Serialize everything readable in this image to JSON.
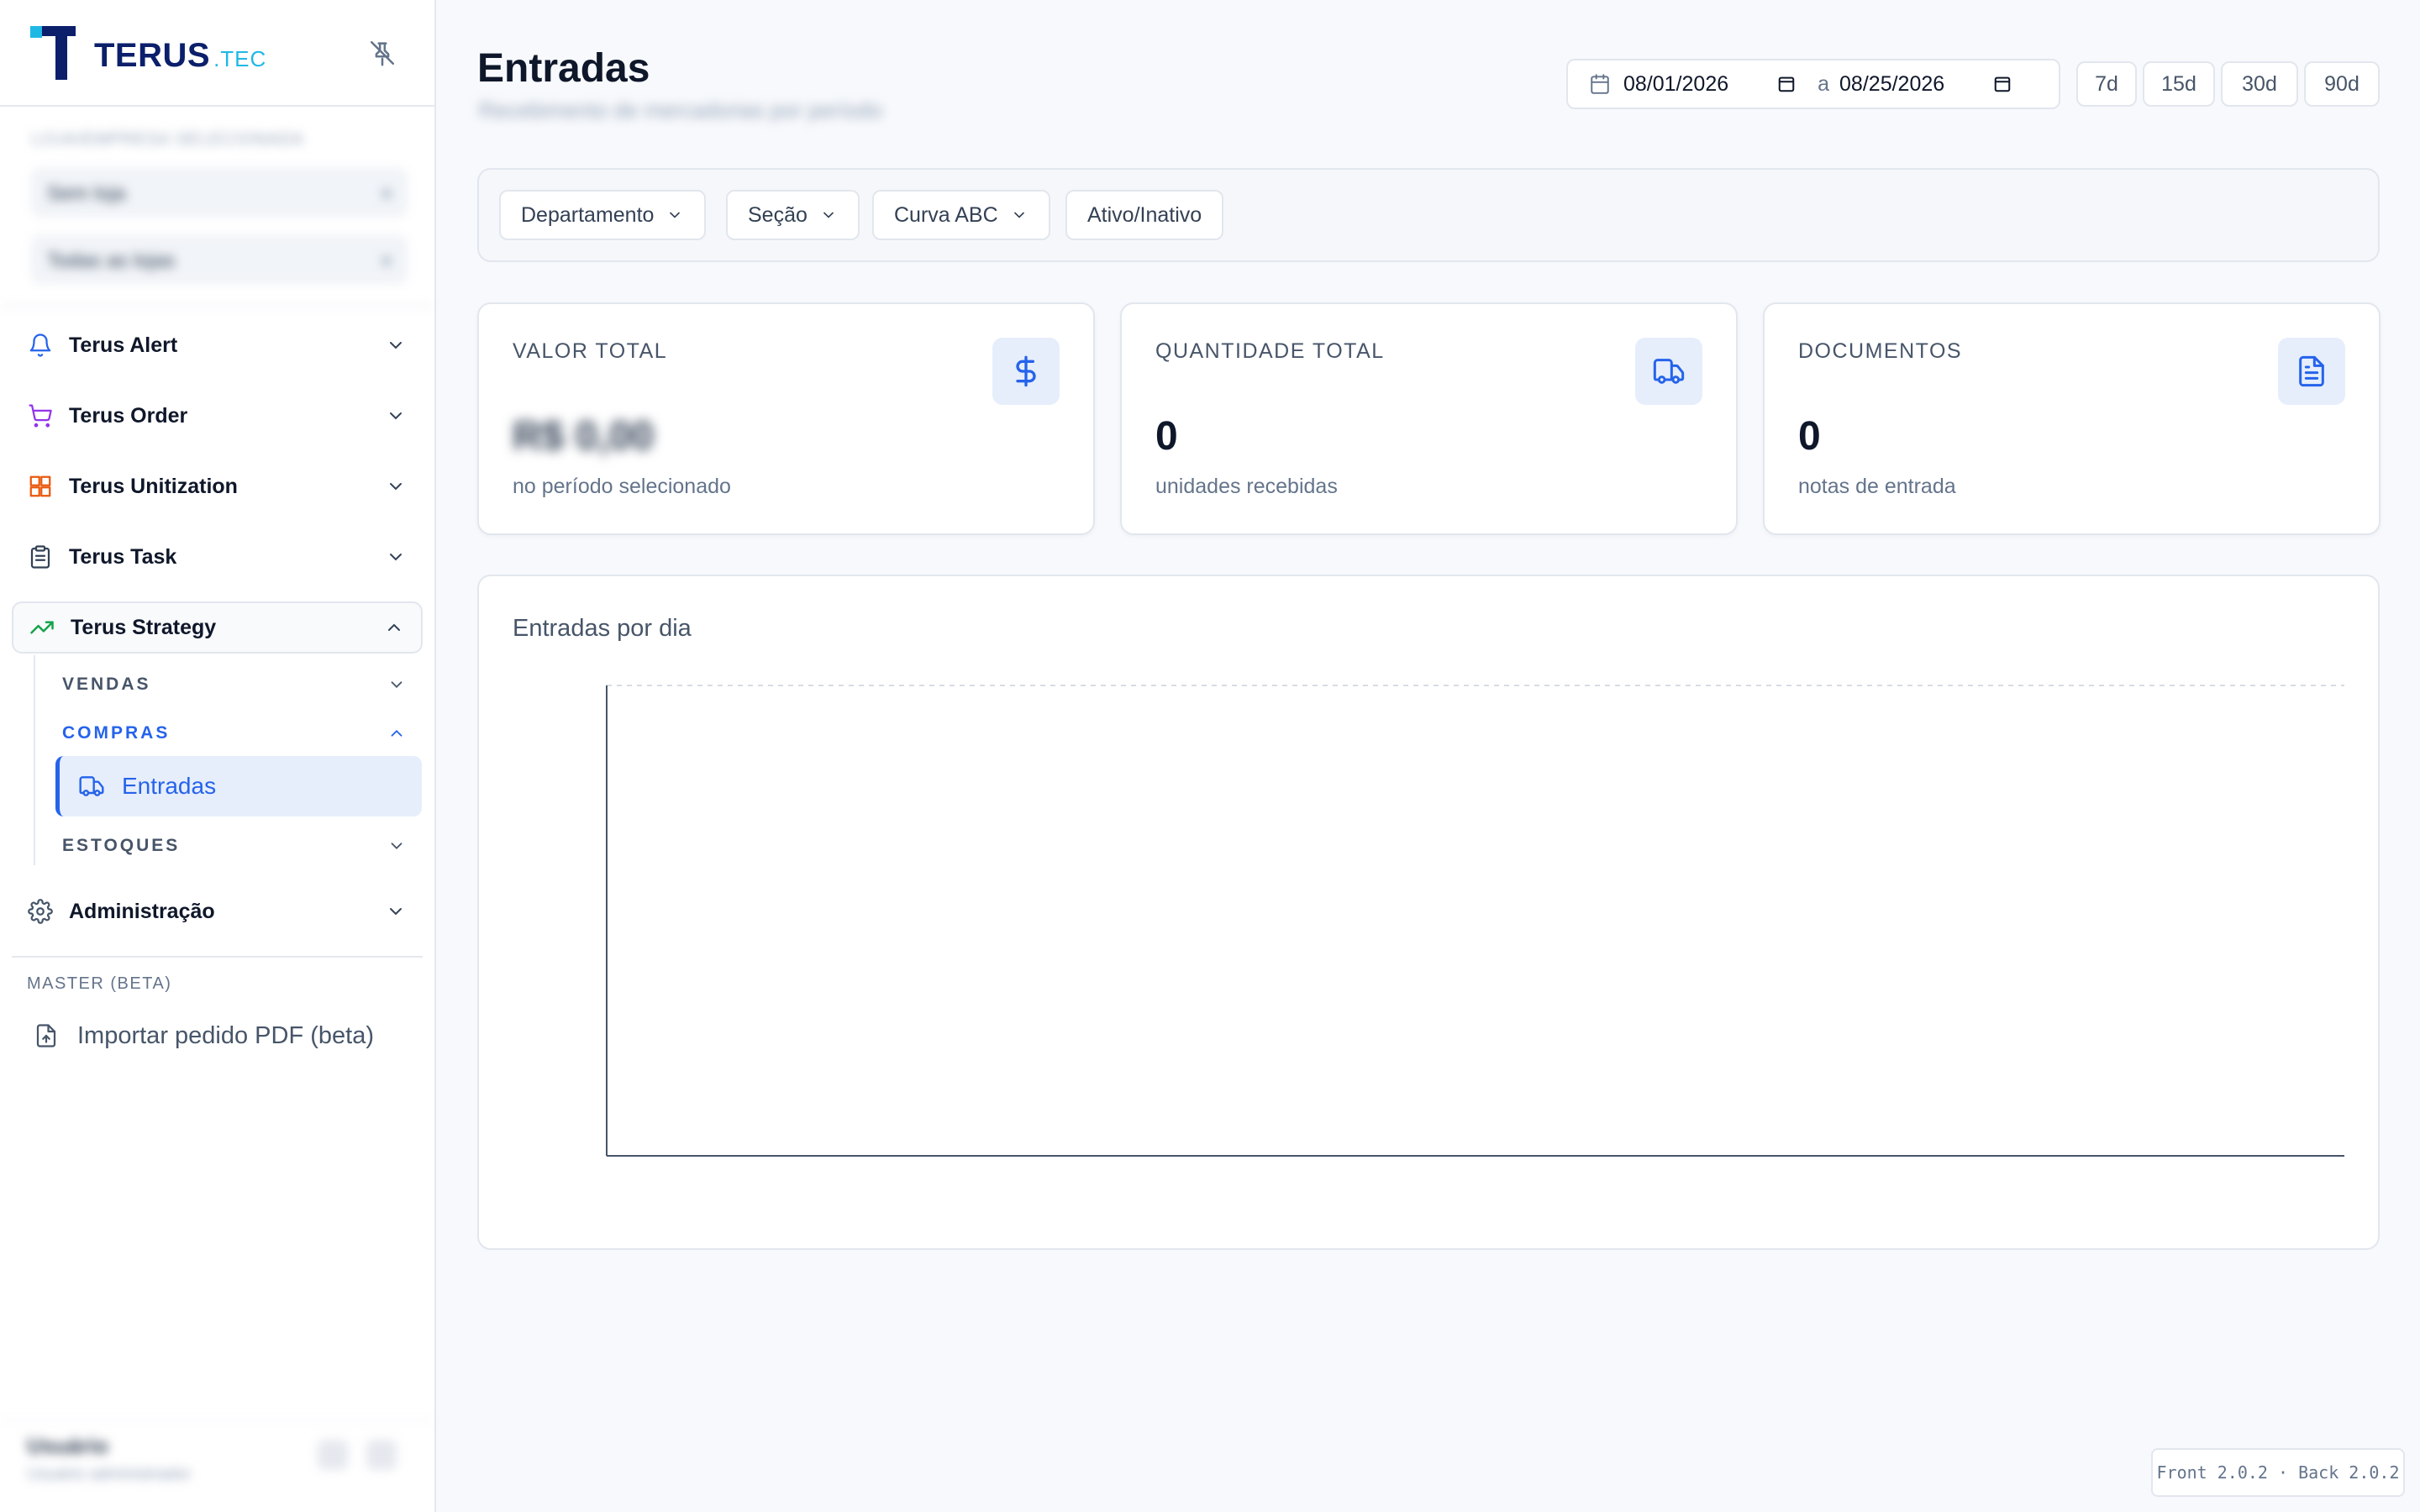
{
  "brand": {
    "name": "TERUS",
    "suffix": ".TEC"
  },
  "sidebar": {
    "selector_label": "LOJA/EMPRESA SELECIONADA",
    "selector_primary": "Sem loja",
    "selector_secondary": "Todas as lojas",
    "items": [
      {
        "label": "Terus Alert"
      },
      {
        "label": "Terus Order"
      },
      {
        "label": "Terus Unitization"
      },
      {
        "label": "Terus Task"
      },
      {
        "label": "Terus Strategy"
      },
      {
        "label": "Administração"
      }
    ],
    "strategy_sub": [
      {
        "label": "VENDAS"
      },
      {
        "label": "COMPRAS"
      },
      {
        "label": "ESTOQUES"
      }
    ],
    "active_leaf": "Entradas",
    "master_section": "MASTER (BETA)",
    "import_pdf": "Importar pedido PDF (beta)",
    "user_name": "Usuário",
    "user_role": "Usuário administrador"
  },
  "header": {
    "title": "Entradas",
    "subtitle": "Recebimento de mercadorias por período",
    "date_from": "08/01/2026",
    "date_separator": "a",
    "date_to": "08/25/2026",
    "presets": [
      "7d",
      "15d",
      "30d",
      "90d"
    ]
  },
  "filters": [
    "Departamento",
    "Seção",
    "Curva ABC",
    "Ativo/Inativo"
  ],
  "kpis": [
    {
      "title": "VALOR TOTAL",
      "value": "R$ 0,00",
      "sub": "no período selecionado",
      "icon": "dollar-icon"
    },
    {
      "title": "QUANTIDADE TOTAL",
      "value": "0",
      "sub": "unidades recebidas",
      "icon": "truck-icon"
    },
    {
      "title": "DOCUMENTOS",
      "value": "0",
      "sub": "notas de entrada",
      "icon": "document-icon"
    }
  ],
  "colors": {
    "accent": "#2563eb",
    "brand_dark": "#0b1f6b",
    "brand_light": "#1fb8e5"
  },
  "chart_data": {
    "type": "bar",
    "title": "Entradas por dia",
    "categories": [],
    "values": [],
    "grid": true
  },
  "version": "Front 2.0.2 · Back 2.0.2"
}
